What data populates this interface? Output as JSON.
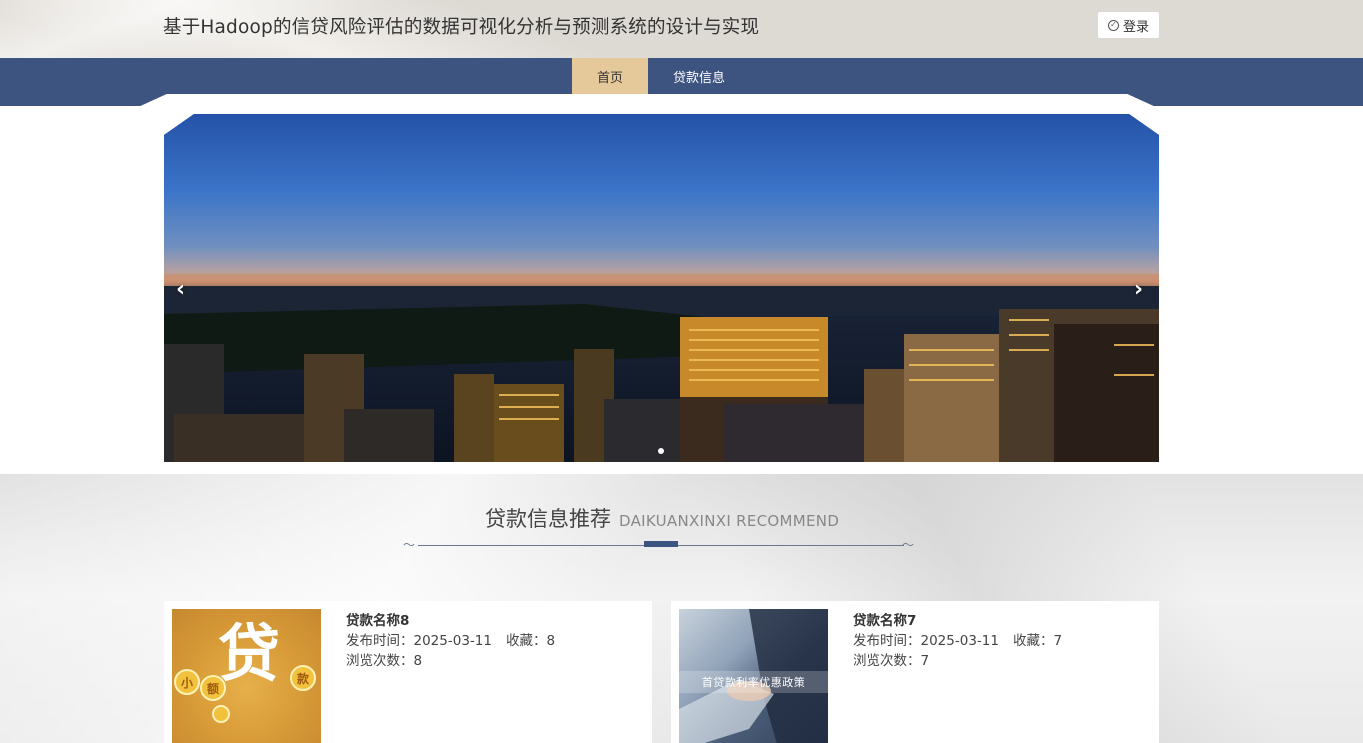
{
  "header": {
    "title": "基于Hadoop的信贷风险评估的数据可视化分析与预测系统的设计与实现",
    "login_label": "登录"
  },
  "nav": {
    "items": [
      {
        "label": "首页",
        "active": true
      },
      {
        "label": "贷款信息",
        "active": false
      }
    ]
  },
  "banner": {
    "prev_arrow": "‹",
    "next_arrow": "›",
    "slide_count": 1,
    "active_slide": 1
  },
  "recommend": {
    "title_cn": "贷款信息推荐",
    "title_en": "DAIKUANXINXI RECOMMEND",
    "cards": [
      {
        "name": "贷款名称8",
        "publish_label": "发布时间：",
        "publish_date": "2025-03-11",
        "fav_label": "收藏：",
        "fav_count": "8",
        "views_label": "浏览次数：",
        "views_count": "8",
        "thumb_glyph": "贷",
        "thumb_coins": [
          "小",
          "额",
          "款"
        ]
      },
      {
        "name": "贷款名称7",
        "publish_label": "发布时间：",
        "publish_date": "2025-03-11",
        "fav_label": "收藏：",
        "fav_count": "7",
        "views_label": "浏览次数：",
        "views_count": "7",
        "thumb_caption": "首贷款利率优惠政策"
      }
    ]
  },
  "colors": {
    "nav_bg": "#3d5380",
    "nav_active_bg": "#e6c99b",
    "accent": "#3d5380"
  }
}
